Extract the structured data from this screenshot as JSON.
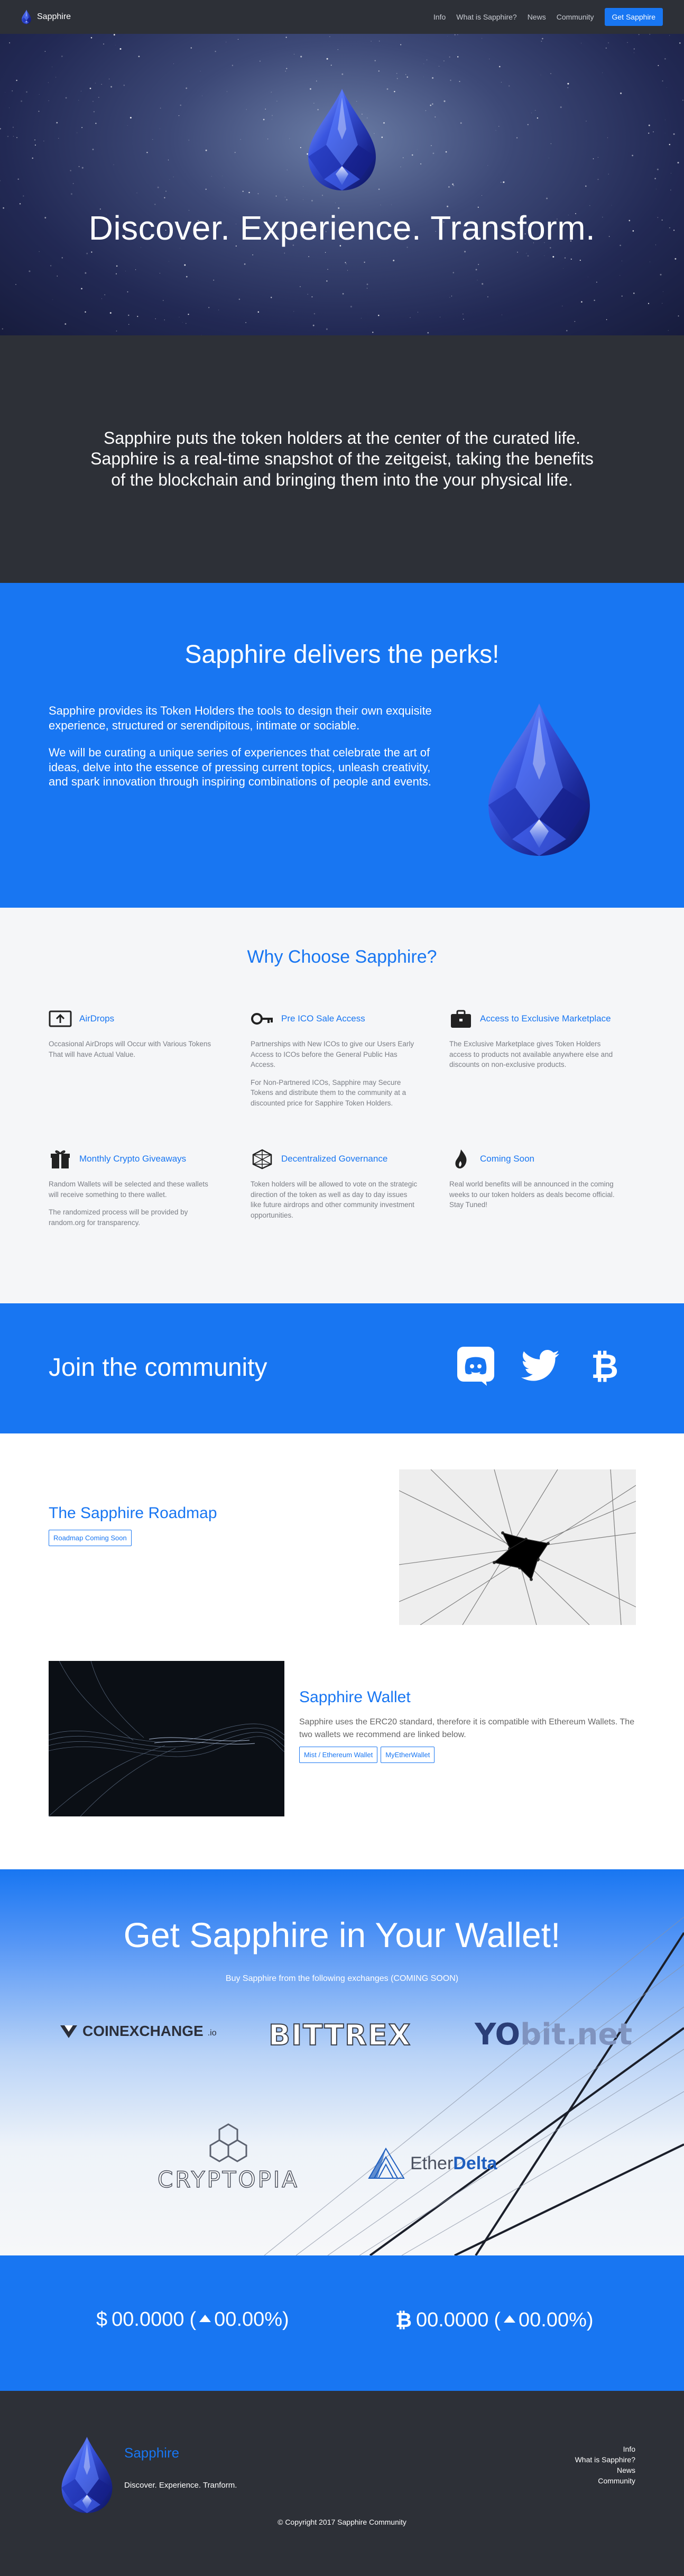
{
  "nav": {
    "brand": "Sapphire",
    "links": [
      "Info",
      "What is Sapphire?",
      "News",
      "Community"
    ],
    "cta": "Get Sapphire"
  },
  "hero": {
    "title": "Discover. Experience. Transform."
  },
  "intro": {
    "text": "Sapphire puts the token holders at the center of the curated life.  Sapphire is a real-time snapshot of the zeitgeist, taking the benefits of the blockchain and bringing them into the your physical life."
  },
  "perks": {
    "title": "Sapphire delivers the perks!",
    "p1": "Sapphire provides its Token Holders the tools to design their own exquisite experience, structured or serendipitous, intimate or sociable.",
    "p2": "We will be curating a unique series of experiences that celebrate the art of ideas, delve into the essence of pressing current topics, unleash creativity, and spark innovation through inspiring combinations of people and events."
  },
  "why": {
    "title": "Why Choose Sapphire?",
    "features": [
      {
        "title": "AirDrops",
        "icon": "airdrop-icon",
        "desc": [
          "Occasional AirDrops will Occur with Various Tokens That will have Actual Value."
        ]
      },
      {
        "title": "Pre ICO Sale Access",
        "icon": "key-icon",
        "desc": [
          "Partnerships with New ICOs to give our Users Early Access to ICOs before the General Public Has Access.",
          "For Non-Partnered ICOs, Sapphire may Secure Tokens and distribute them to the community at a discounted price for Sapphire Token Holders."
        ]
      },
      {
        "title": "Access to Exclusive Marketplace",
        "icon": "briefcase-icon",
        "desc": [
          "The Exclusive Marketplace gives Token Holders access to products not available anywhere else and discounts on non-exclusive products."
        ]
      },
      {
        "title": "Monthly Crypto Giveaways",
        "icon": "gift-icon",
        "desc": [
          "Random Wallets will be selected and these wallets will receive something to there wallet.",
          "The randomized process will be provided by random.org for transparency."
        ]
      },
      {
        "title": "Decentralized Governance",
        "icon": "network-icon",
        "desc": [
          "Token holders will be allowed to vote on the strategic direction of the token as well as day to day issues like future airdrops and other community investment opportunities."
        ]
      },
      {
        "title": "Coming Soon",
        "icon": "flame-icon",
        "desc": [
          "Real world benefits will be announced in the coming weeks to our token holders as deals become official. Stay Tuned!"
        ]
      }
    ]
  },
  "community": {
    "title": "Join the community",
    "icons": [
      "discord-icon",
      "twitter-icon",
      "bitcoin-icon"
    ]
  },
  "roadmap": {
    "title": "The Sapphire Roadmap",
    "button": "Roadmap Coming Soon"
  },
  "wallet": {
    "title": "Sapphire Wallet",
    "desc": "Sapphire uses the ERC20 standard, therefore it is compatible with Ethereum Wallets. The two wallets we recommend are linked below.",
    "buttons": [
      "Mist / Ethereum Wallet",
      "MyEtherWallet"
    ]
  },
  "exchanges": {
    "title": "Get Sapphire in Your Wallet!",
    "subtitle": "Buy Sapphire from the following exchanges (COMING SOON)",
    "logos": {
      "coinexchange": "COINEXCHANGE",
      "coinexchange_suffix": ".io",
      "bittrex": "BITTREX",
      "yobit_yo": "YO",
      "yobit_rest": "bit.net",
      "cryptopia": "CRYPTOPIA",
      "etherdelta_a": "Ether",
      "etherdelta_b": "Delta"
    }
  },
  "prices": {
    "usd": {
      "symbol": "$",
      "value": "00.0000",
      "change": "00.00%)",
      "open": "("
    },
    "btc": {
      "symbol": "₿",
      "value": "00.0000",
      "change": "00.00%)",
      "open": "("
    }
  },
  "footer": {
    "brand": "Sapphire",
    "tagline": "Discover. Experience. Tranform.",
    "links": [
      "Info",
      "What is Sapphire?",
      "News",
      "Community"
    ],
    "copyright": "© Copyright 2017 Sapphire Community"
  },
  "colors": {
    "accent": "#1876f2",
    "dark": "#2d3037"
  }
}
